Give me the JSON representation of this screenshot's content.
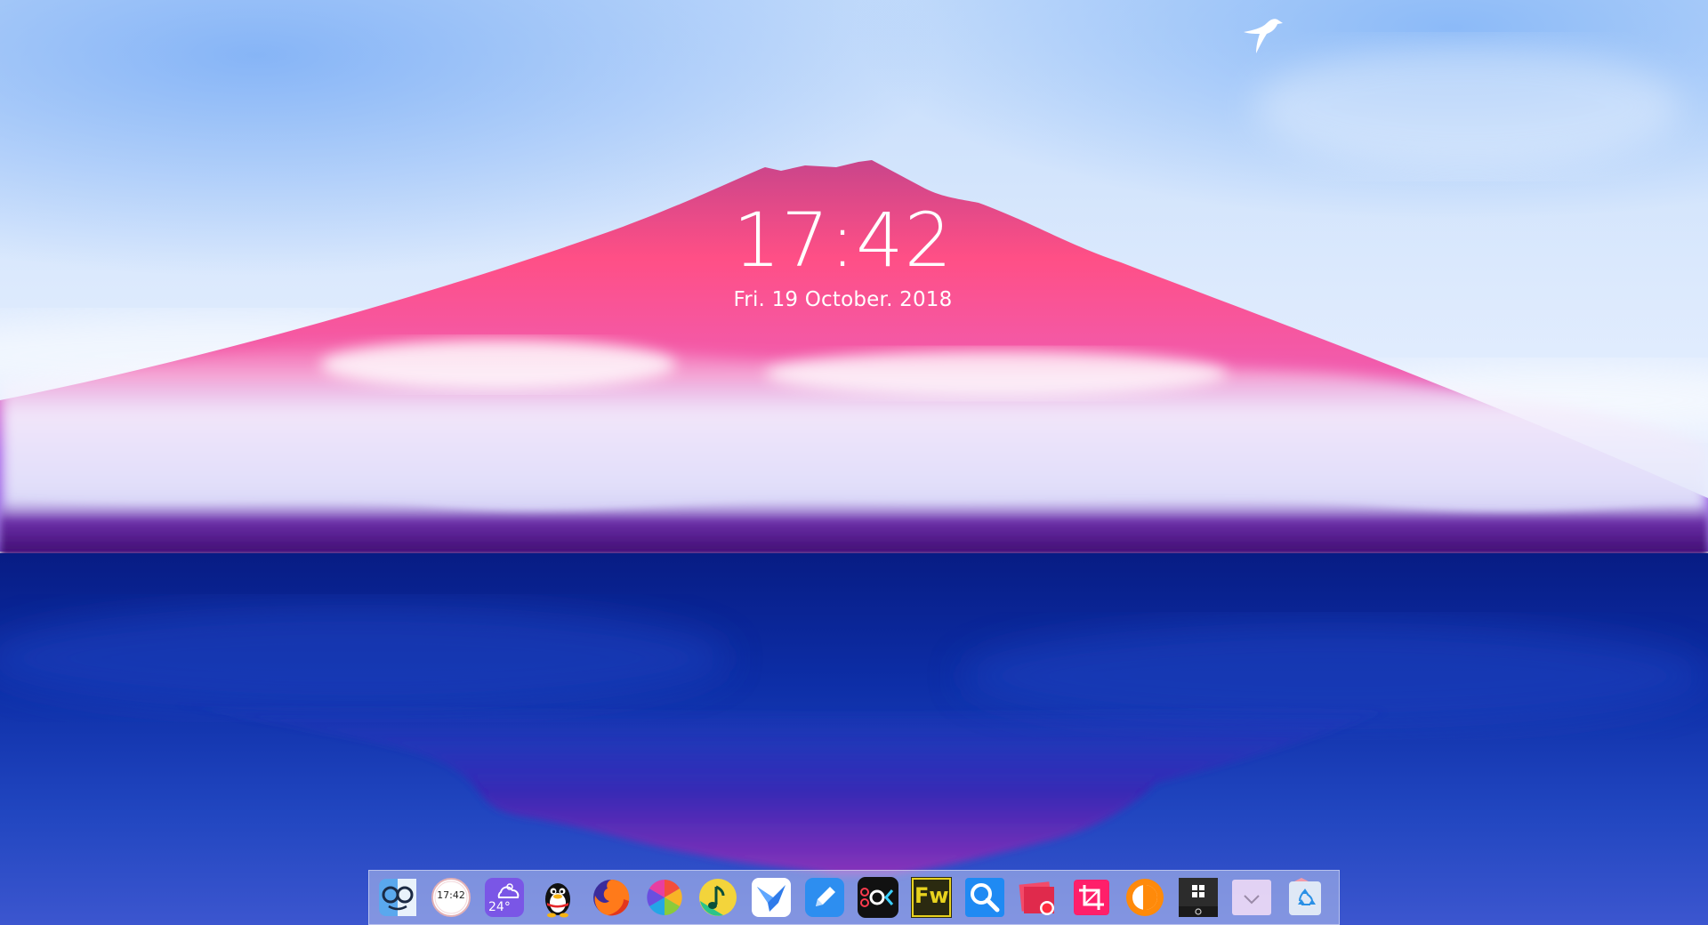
{
  "clock": {
    "time": "17:42",
    "date": "Fri. 19 October. 2018"
  },
  "colors": {
    "sky_top": "#cfe1fb",
    "mountain_peak": "#d8407a",
    "mountain_pink": "#ff4f8b",
    "mountain_purple": "#8b2ee0",
    "water_deep": "#0a1f86",
    "water_mid": "#2b49c8",
    "dock_bg": "#bec8f0"
  },
  "dock": {
    "items": [
      {
        "name": "finder-icon",
        "label": ""
      },
      {
        "name": "clock-app-icon",
        "label": "17:42"
      },
      {
        "name": "weather-icon",
        "label": "24°"
      },
      {
        "name": "qq-penguin-icon",
        "label": ""
      },
      {
        "name": "firefox-icon",
        "label": ""
      },
      {
        "name": "photos-pinwheel-icon",
        "label": ""
      },
      {
        "name": "music-note-icon",
        "label": ""
      },
      {
        "name": "mail-bird-icon",
        "label": ""
      },
      {
        "name": "pen-edit-icon",
        "label": ""
      },
      {
        "name": "ok-app-icon",
        "label": ""
      },
      {
        "name": "fireworks-icon",
        "label": "Fw"
      },
      {
        "name": "search-magnifier-icon",
        "label": ""
      },
      {
        "name": "screen-record-icon",
        "label": ""
      },
      {
        "name": "crop-tool-icon",
        "label": ""
      },
      {
        "name": "orange-circle-icon",
        "label": ""
      },
      {
        "name": "windows-start-icon",
        "label": ""
      },
      {
        "name": "downloads-folder-icon",
        "label": ""
      },
      {
        "name": "recycle-bin-icon",
        "label": ""
      }
    ]
  }
}
